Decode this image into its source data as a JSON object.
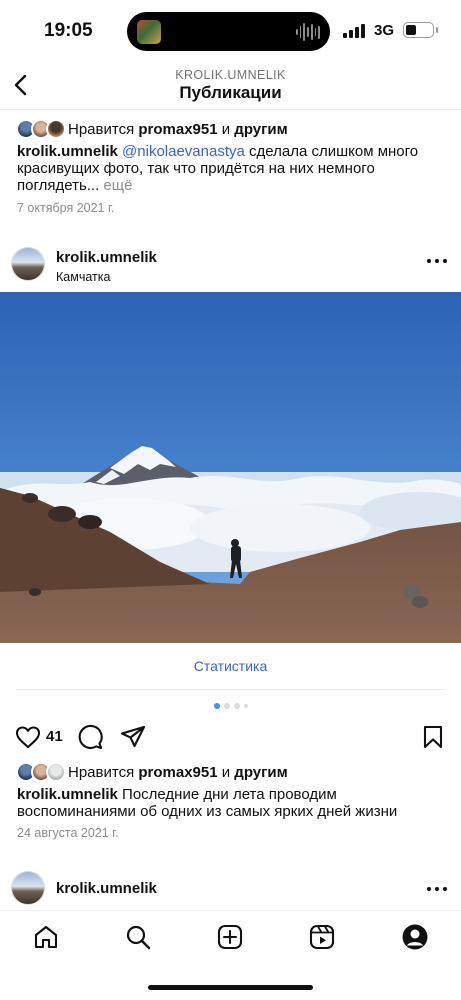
{
  "status_bar": {
    "time": "19:05",
    "network": "3G",
    "battery_level": 0.4
  },
  "header": {
    "back_icon": "chevron-left-icon",
    "account": "KROLIK.UMNELIK",
    "title": "Публикации"
  },
  "prev_post": {
    "likes_prefix": "Нравится ",
    "likes_user": "promax951",
    "likes_mid": " и ",
    "likes_others": "другим",
    "caption_user": "krolik.umnelik",
    "caption_mention": "@nikolaevanastya",
    "caption_text": " сделала слишком много красивущих фото, так что придётся на них немного поглядеть...",
    "caption_more": " ещё",
    "date": "7 октября 2021 г."
  },
  "post": {
    "username": "krolik.umnelik",
    "location": "Камчатка",
    "statistics_link": "Статистика",
    "carousel": {
      "count": 4,
      "active": 0
    },
    "like_count": "41",
    "likes_prefix": "Нравится ",
    "likes_user": "promax951",
    "likes_mid": " и ",
    "likes_others": "другим",
    "caption_user": "krolik.umnelik",
    "caption_text": " Последние дни лета проводим воспоминаниями об одних из самых ярких дней жизни",
    "date": "24 августа 2021 г."
  },
  "next_post": {
    "username": "krolik.umnelik"
  },
  "tabbar": {
    "items": [
      "home-icon",
      "search-icon",
      "create-icon",
      "reels-icon",
      "profile-icon"
    ]
  },
  "colors": {
    "link": "#3b63d4",
    "pager_active": "#3897f0",
    "muted": "#8e8e8e"
  }
}
